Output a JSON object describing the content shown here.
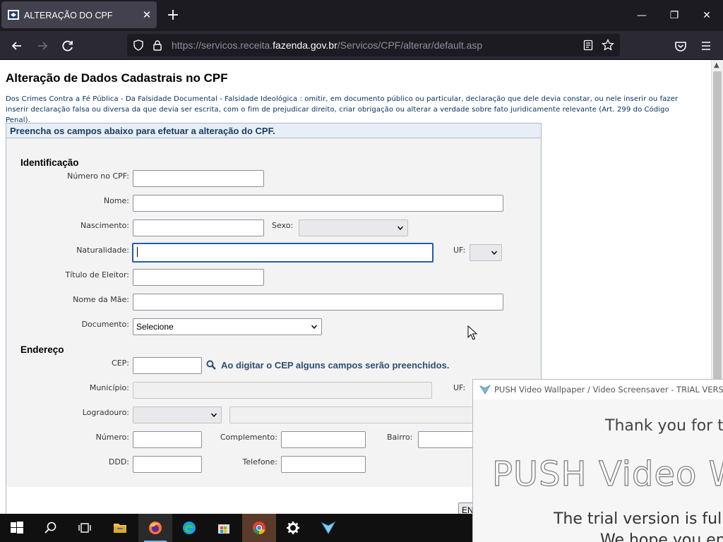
{
  "browser": {
    "tab_title": "ALTERAÇÃO DO CPF",
    "tab_close": "✕",
    "new_tab": "+",
    "url_prefix": "https://servicos.receita.",
    "url_host": "fazenda.gov.br",
    "url_path": "/Servicos/CPF/alterar/default.asp",
    "window_controls": {
      "minimize": "—",
      "restore": "❐",
      "close": "✕"
    }
  },
  "page": {
    "title": "Alteração de Dados Cadastrais no CPF",
    "legal_notice": "Dos Crimes Contra a Fé Pública - Da Falsidade Documental - Falsidade Ideológica : omitir, em documento público ou particular, declaração que dele devia constar, ou nele inserir ou fazer inserir declaração falsa ou diversa da que devia ser escrita, com o fim de prejudicar direito, criar obrigação ou alterar a verdade sobre fato juridicamente relevante (Art. 299 do Código Penal).",
    "form_header": "Preencha os campos abaixo para efetuar a alteração do CPF.",
    "identificacao": {
      "heading": "Identificação",
      "cpf_label": "Número no CPF:",
      "nome_label": "Nome:",
      "nascimento_label": "Nascimento:",
      "sexo_label": "Sexo:",
      "sexo_value": "",
      "naturalidade_label": "Naturalidade:",
      "uf_label": "UF:",
      "uf_value": "",
      "titulo_label": "Título de Eleitor:",
      "mae_label": "Nome da Mãe:",
      "documento_label": "Documento:",
      "documento_value": "Selecione"
    },
    "endereco": {
      "heading": "Endereço",
      "cep_label": "CEP:",
      "cep_hint": "Ao digitar o CEP alguns campos serão preenchidos.",
      "municipio_label": "Município:",
      "uf_label": "UF:",
      "logradouro_label": "Logradouro:",
      "numero_label": "Número:",
      "complemento_label": "Complemento:",
      "bairro_label": "Bairro:",
      "ddd_label": "DDD:",
      "telefone_label": "Telefone:"
    },
    "submit_label": "ENVIAR"
  },
  "popup": {
    "title": "PUSH Video Wallpaper / Video Screensaver - TRIAL VERSION",
    "thanks": "Thank you for tr",
    "big_text": "PUSH Video W",
    "trial_text": "The trial version is fully",
    "hope_text": "We hope you en"
  },
  "colors": {
    "form_header_text": "#183d63",
    "legal_text": "#002e5b",
    "focus_border": "#1f5ea8"
  }
}
